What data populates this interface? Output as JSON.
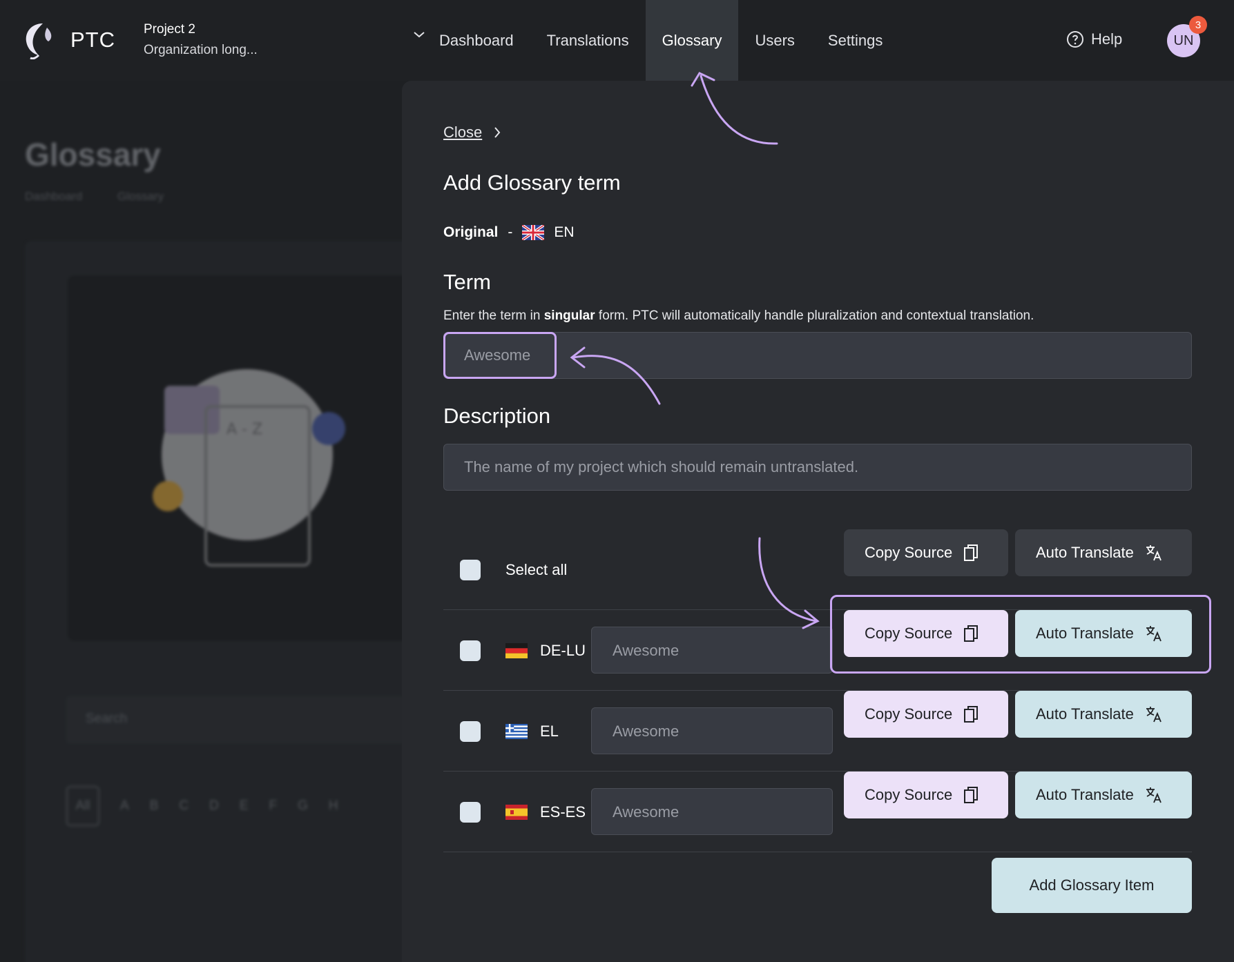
{
  "header": {
    "brand": "PTC",
    "project": "Project  2",
    "organization": "Organization long...",
    "nav": [
      {
        "label": "Dashboard",
        "active": false
      },
      {
        "label": "Translations",
        "active": false
      },
      {
        "label": "Glossary",
        "active": true
      },
      {
        "label": "Users",
        "active": false
      },
      {
        "label": "Settings",
        "active": false
      }
    ],
    "help": "Help",
    "avatar": "UN",
    "notifications": "3"
  },
  "background_page": {
    "title": "Glossary",
    "breadcrumb": [
      "Dashboard",
      "Glossary"
    ],
    "search_placeholder": "Search",
    "letters": [
      "All",
      "A",
      "B",
      "C",
      "D",
      "E",
      "F",
      "G",
      "H"
    ]
  },
  "drawer": {
    "close": "Close",
    "title": "Add Glossary term",
    "original_label": "Original",
    "original_dash": "-",
    "original_lang": "EN",
    "term_heading": "Term",
    "term_help_before": "Enter the term in ",
    "term_help_bold": "singular",
    "term_help_after": " form. PTC will automatically handle pluralization and contextual translation.",
    "term_value": "Awesome",
    "description_heading": "Description",
    "description_value": "The name of my project which should remain untranslated.",
    "select_all": "Select all",
    "copy_source": "Copy Source",
    "auto_translate": "Auto Translate",
    "languages": [
      {
        "code": "DE-LU",
        "value": "Awesome",
        "flag": "de"
      },
      {
        "code": "EL",
        "value": "Awesome",
        "flag": "gr"
      },
      {
        "code": "ES-ES",
        "value": "Awesome",
        "flag": "es"
      }
    ],
    "add_button": "Add Glossary Item"
  },
  "colors": {
    "accent_purple": "#c9a6f3",
    "copy_button": "#ece1f8",
    "auto_button": "#cde4ea",
    "badge": "#ec5a3d"
  }
}
